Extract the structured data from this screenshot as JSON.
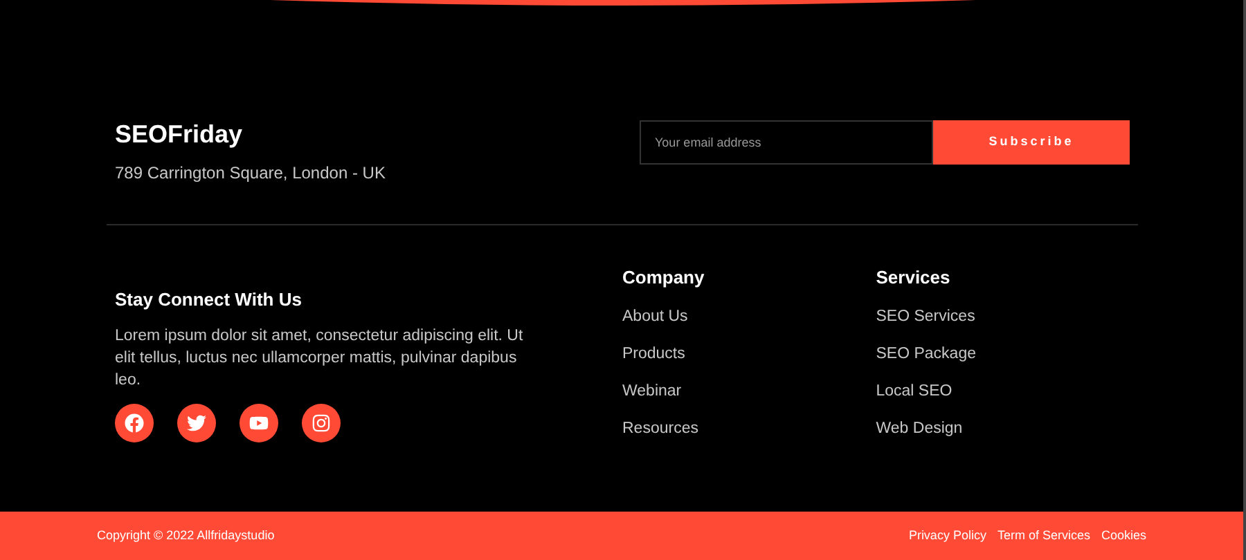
{
  "brand": {
    "name": "SEOFriday",
    "address": "789 Carrington Square, London - UK"
  },
  "newsletter": {
    "placeholder": "Your email address",
    "button": "Subscribe"
  },
  "about": {
    "title": "Stay Connect With Us",
    "text": "Lorem ipsum dolor sit amet, consectetur adipiscing elit. Ut elit tellus, luctus nec ullamcorper mattis, pulvinar dapibus leo.",
    "social": [
      {
        "kind": "facebook"
      },
      {
        "kind": "twitter"
      },
      {
        "kind": "youtube"
      },
      {
        "kind": "instagram"
      }
    ]
  },
  "columns": [
    {
      "title": "Company",
      "links": [
        "About Us",
        "Products",
        "Webinar",
        "Resources"
      ]
    },
    {
      "title": "Services",
      "links": [
        "SEO Services",
        "SEO Package",
        "Local SEO",
        "Web Design"
      ]
    }
  ],
  "bottom_bar": {
    "copyright": "Copyright © 2022 Allfridaystudio",
    "links": [
      "Privacy Policy",
      "Term of Services",
      "Cookies"
    ]
  }
}
